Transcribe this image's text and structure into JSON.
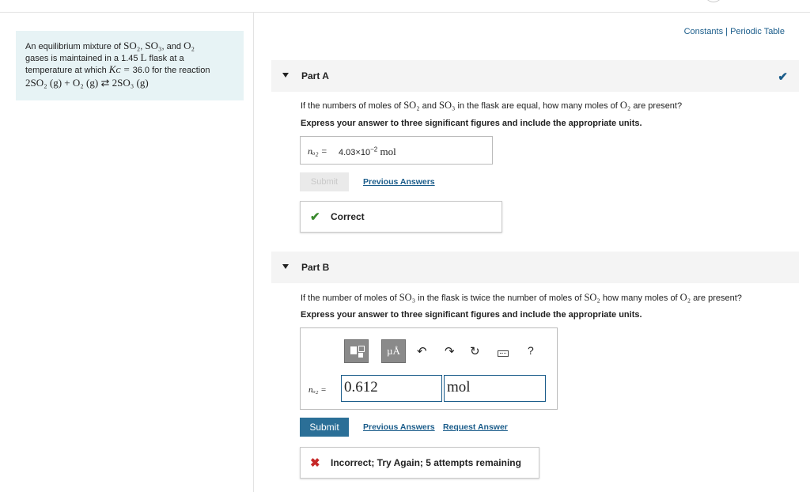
{
  "problem": {
    "line1_a": "An equilibrium mixture of ",
    "so2": "SO₂",
    "so3": "SO₃",
    "o2": "O₂",
    "line1_sep": ", ",
    "line1_and": ", and ",
    "line2": "gases is maintained in a 1.45 ",
    "line2_unit": "L",
    "line2_end": " flask at a",
    "line3": "temperature at which ",
    "kc": "Kᴄ = ",
    "line3_end": "36.0 for the reaction",
    "reaction": "2SO₂ (g) + O₂ (g) ⇄ 2SO₃ (g)"
  },
  "toplinks": {
    "constants": "Constants",
    "sep": " | ",
    "periodic": "Periodic Table"
  },
  "partA": {
    "title": "Part A",
    "question_a": "If the numbers of moles of ",
    "question_so2": "SO₂",
    "question_and": " and ",
    "question_so3": "SO₃",
    "question_b": " in the flask are equal, how many moles of ",
    "question_o2": "O₂",
    "question_c": " are present?",
    "instruction": "Express your answer to three significant figures and include the appropriate units.",
    "answer_label": "nₒ₂ = ",
    "answer_value": "4.03×10",
    "answer_exp": "−2",
    "answer_unit": " mol",
    "submit_label": "Submit",
    "previous_answers": "Previous Answers",
    "feedback": "Correct"
  },
  "partB": {
    "title": "Part B",
    "question_a": "If the number of moles of ",
    "question_so3": "SO₃",
    "question_b": " in the flask is twice the number of moles of ",
    "question_so2": "SO₂",
    "question_c": " how many moles of ",
    "question_o2": "O₂",
    "question_d": " are present?",
    "instruction": "Express your answer to three significant figures and include the appropriate units.",
    "toolbar_units": "µÅ",
    "toolbar_help": "?",
    "field_label": "nₒ₂ = ",
    "value": "0.612",
    "unit": "mol",
    "submit_label": "Submit",
    "previous_answers": "Previous Answers",
    "request_answer": "Request Answer",
    "feedback": "Incorrect; Try Again; 5 attempts remaining"
  },
  "colors": {
    "accent": "#2b6f97",
    "link": "#1a5c8a",
    "correct": "#3a8a2e",
    "incorrect": "#c62828",
    "problem_bg": "#e7f3f5"
  }
}
